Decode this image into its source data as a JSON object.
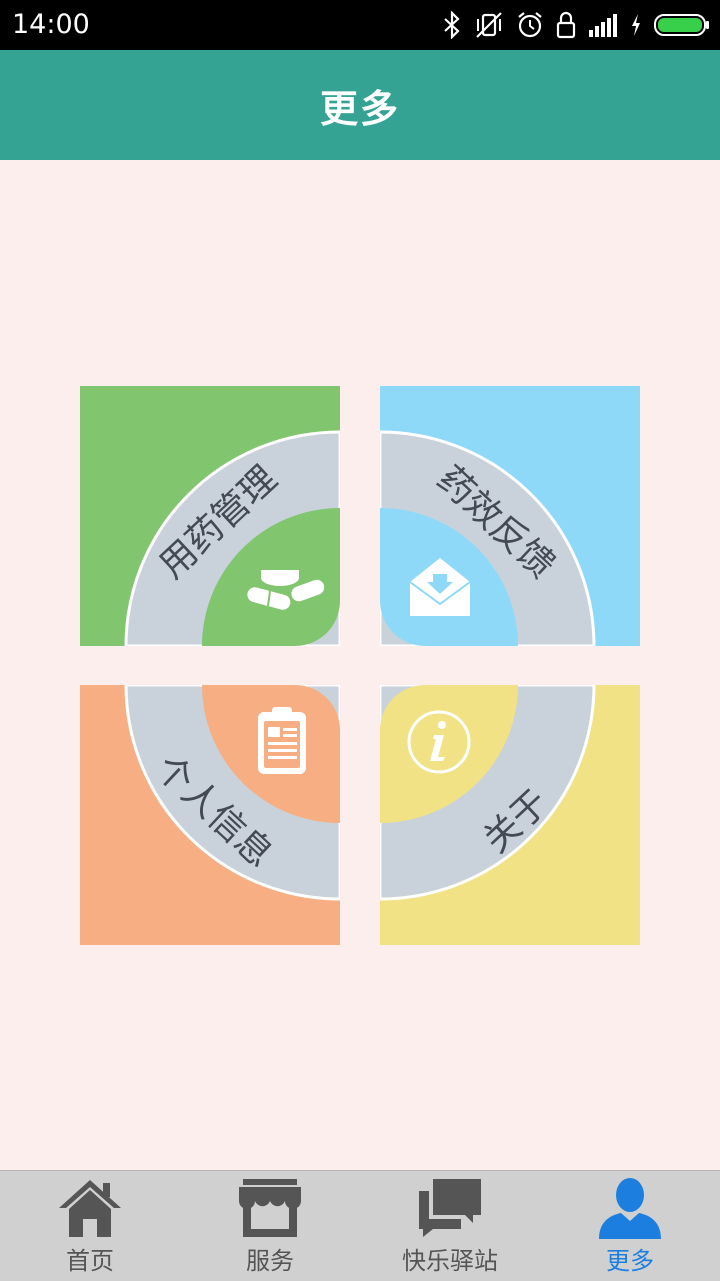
{
  "status_bar": {
    "time": "14:00",
    "icons": [
      "bluetooth-icon",
      "vibrate-off-icon",
      "alarm-icon",
      "lock-icon",
      "signal-icon",
      "charging-icon",
      "battery-icon"
    ],
    "battery_color": "#38d04a"
  },
  "header": {
    "title": "更多"
  },
  "tiles": [
    {
      "label": "用药管理",
      "icon": "pills-icon",
      "color": "#81c56f"
    },
    {
      "label": "药效反馈",
      "icon": "envelope-icon",
      "color": "#8fd9f8"
    },
    {
      "label": "个人信息",
      "icon": "clipboard-icon",
      "color": "#f7ae82"
    },
    {
      "label": "关于",
      "icon": "info-icon",
      "color": "#f1e286"
    }
  ],
  "colors": {
    "ring": "#c9d2da",
    "background": "#fdeeee",
    "header": "#34a394",
    "nav_active": "#1c7fe0"
  },
  "bottom_nav": {
    "items": [
      {
        "label": "首页",
        "icon": "home-icon"
      },
      {
        "label": "服务",
        "icon": "store-icon"
      },
      {
        "label": "快乐驿站",
        "icon": "chat-icon"
      },
      {
        "label": "更多",
        "icon": "person-icon",
        "active": true
      }
    ]
  }
}
